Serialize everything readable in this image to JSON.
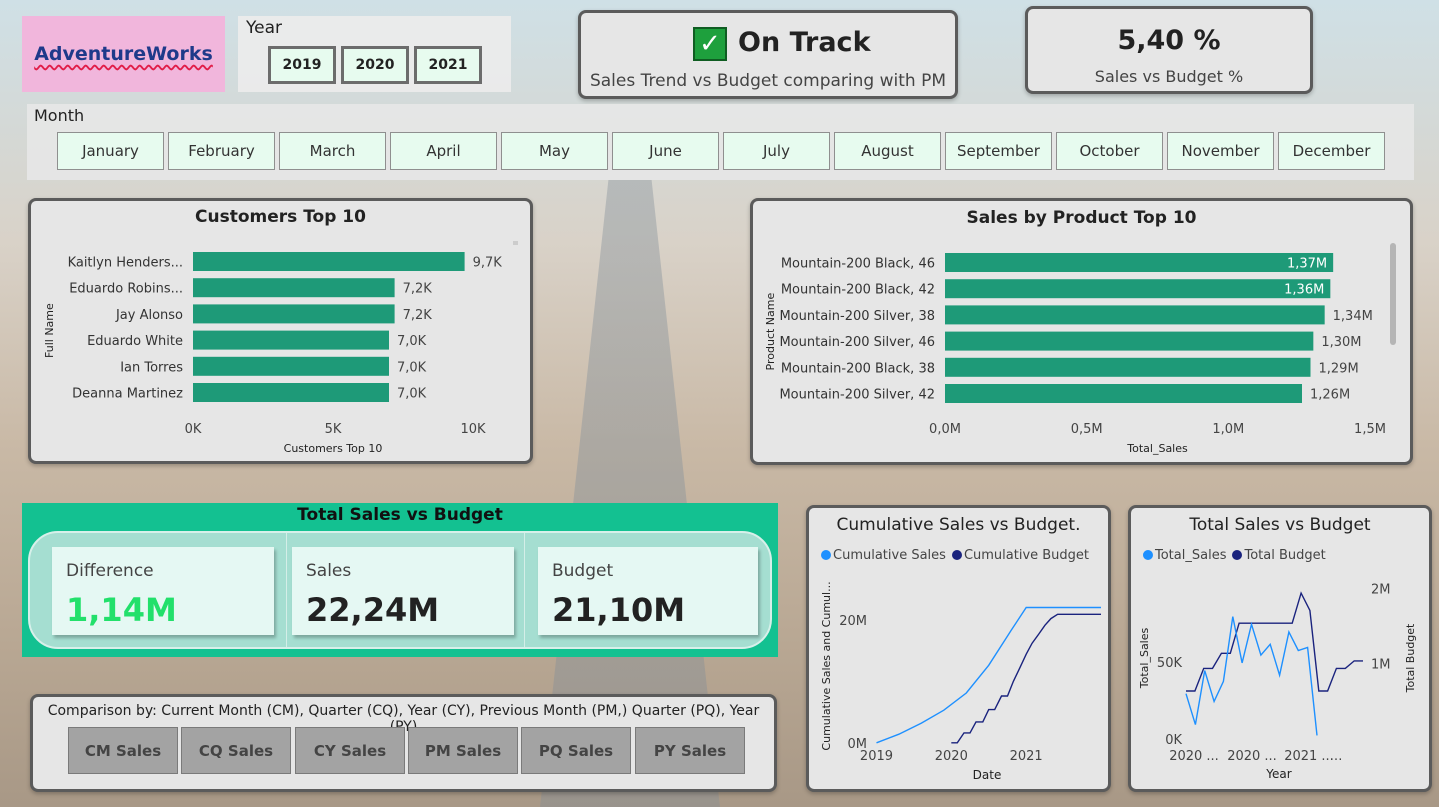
{
  "logo": {
    "text": "AdventureWorks"
  },
  "year_slicer": {
    "label": "Year",
    "options": [
      "2019",
      "2020",
      "2021"
    ]
  },
  "status_card": {
    "status": "On Track",
    "subtitle": "Sales Trend vs Budget comparing with PM",
    "icon": "check-icon"
  },
  "pct_card": {
    "value": "5,40 %",
    "subtitle": "Sales vs Budget %"
  },
  "month_slicer": {
    "label": "Month",
    "options": [
      "January",
      "February",
      "March",
      "April",
      "May",
      "June",
      "July",
      "August",
      "September",
      "October",
      "November",
      "December"
    ]
  },
  "total_sales_vs_budget": {
    "title": "Total Sales vs Budget",
    "difference": {
      "label": "Difference",
      "value": "1,14M",
      "color": "#22e06b"
    },
    "sales": {
      "label": "Sales",
      "value": "22,24M"
    },
    "budget": {
      "label": "Budget",
      "value": "21,10M"
    }
  },
  "comparison": {
    "label": "Comparison by: Current Month (CM), Quarter (CQ), Year (CY), Previous Month (PM,) Quarter (PQ), Year (PY)",
    "buttons": [
      "CM Sales",
      "CQ Sales",
      "CY Sales",
      "PM Sales",
      "PQ Sales",
      "PY Sales"
    ]
  },
  "colors": {
    "bar": "#1e9a78",
    "accent": "#13c191",
    "cum_sales": "#1e90ff",
    "cum_budget": "#1a237e"
  },
  "chart_data": [
    {
      "type": "bar",
      "orientation": "horizontal",
      "title": "Customers Top 10",
      "xlabel": "Customers Top 10",
      "ylabel": "Full Name",
      "categories": [
        "Kaitlyn Henders...",
        "Eduardo Robins...",
        "Jay Alonso",
        "Eduardo White",
        "Ian Torres",
        "Deanna Martinez"
      ],
      "values": [
        9700,
        7200,
        7200,
        7000,
        7000,
        7000
      ],
      "data_labels": [
        "9,7K",
        "7,2K",
        "7,2K",
        "7,0K",
        "7,0K",
        "7,0K"
      ],
      "xlim": [
        0,
        10000
      ],
      "xticks": [
        "0K",
        "5K",
        "10K"
      ],
      "xtick_values": [
        0,
        5000,
        10000
      ]
    },
    {
      "type": "bar",
      "orientation": "horizontal",
      "title": "Sales by Product Top 10",
      "xlabel": "Total_Sales",
      "ylabel": "Product Name",
      "categories": [
        "Mountain-200 Black, 46",
        "Mountain-200 Black, 42",
        "Mountain-200 Silver, 38",
        "Mountain-200 Silver, 46",
        "Mountain-200 Black, 38",
        "Mountain-200 Silver, 42"
      ],
      "values": [
        1.37,
        1.36,
        1.34,
        1.3,
        1.29,
        1.26
      ],
      "data_labels": [
        "1,37M",
        "1,36M",
        "1,34M",
        "1,30M",
        "1,29M",
        "1,26M"
      ],
      "xlim": [
        0,
        1.5
      ],
      "xticks": [
        "0,0M",
        "0,5M",
        "1,0M",
        "1,5M"
      ],
      "xtick_values": [
        0,
        0.5,
        1.0,
        1.5
      ]
    },
    {
      "type": "line",
      "title": "Cumulative Sales vs Budget.",
      "xlabel": "Date",
      "ylabel": "Cumulative Sales and Cumul...",
      "x_ticks": [
        "2019",
        "2020",
        "2021"
      ],
      "x_tick_values": [
        2019,
        2020,
        2021
      ],
      "y_ticks": [
        "0M",
        "20M"
      ],
      "y_tick_values": [
        0,
        20
      ],
      "xlim": [
        2018.9,
        2022.0
      ],
      "ylim": [
        0,
        27
      ],
      "series": [
        {
          "name": "Cumulative Sales",
          "x": [
            2019.0,
            2019.3,
            2019.6,
            2019.9,
            2020.2,
            2020.5,
            2020.8,
            2021.0,
            2021.5,
            2022.0
          ],
          "values": [
            0.2,
            1.6,
            3.4,
            5.5,
            8.3,
            12.8,
            18.5,
            22.2,
            22.2,
            22.2
          ]
        },
        {
          "name": "Cumulative Budget",
          "x": [
            2020.0,
            2020.08,
            2020.17,
            2020.25,
            2020.33,
            2020.42,
            2020.5,
            2020.58,
            2020.67,
            2020.75,
            2020.83,
            2020.92,
            2021.0,
            2021.08,
            2021.17,
            2021.25,
            2021.33,
            2021.42,
            2021.5,
            2022.0
          ],
          "values": [
            0.2,
            0.2,
            1.8,
            1.8,
            3.6,
            3.6,
            5.6,
            5.6,
            7.8,
            7.8,
            10.2,
            12.5,
            14.6,
            16.4,
            17.9,
            19.3,
            20.4,
            21.1,
            21.1,
            21.1
          ]
        }
      ]
    },
    {
      "type": "line",
      "title": "Total Sales vs Budget",
      "xlabel": "Year",
      "ylabel": "Total_Sales",
      "y2label": "Total Budget",
      "x_ticks": [
        "2020 ...",
        "2020 ...",
        "2021 ..."
      ],
      "y_ticks": [
        "0K",
        "50K"
      ],
      "y_tick_values": [
        0,
        50000
      ],
      "y2_ticks": [
        "1M",
        "2M"
      ],
      "y2_tick_values": [
        1,
        2
      ],
      "ylim": [
        0,
        105000
      ],
      "y2lim": [
        0,
        2.15
      ],
      "series": [
        {
          "name": "Total_Sales",
          "values": [
            30000,
            10000,
            45000,
            25000,
            38000,
            80000,
            50000,
            75000,
            55000,
            62000,
            42000,
            70000,
            58000,
            60000,
            3000
          ]
        },
        {
          "name": "Total Budget",
          "values": [
            0.65,
            0.65,
            0.95,
            0.95,
            1.15,
            1.15,
            1.55,
            1.55,
            1.55,
            1.55,
            1.55,
            1.55,
            1.55,
            1.95,
            1.72,
            0.65,
            0.65,
            0.95,
            0.95,
            1.05,
            1.05
          ]
        }
      ]
    }
  ]
}
